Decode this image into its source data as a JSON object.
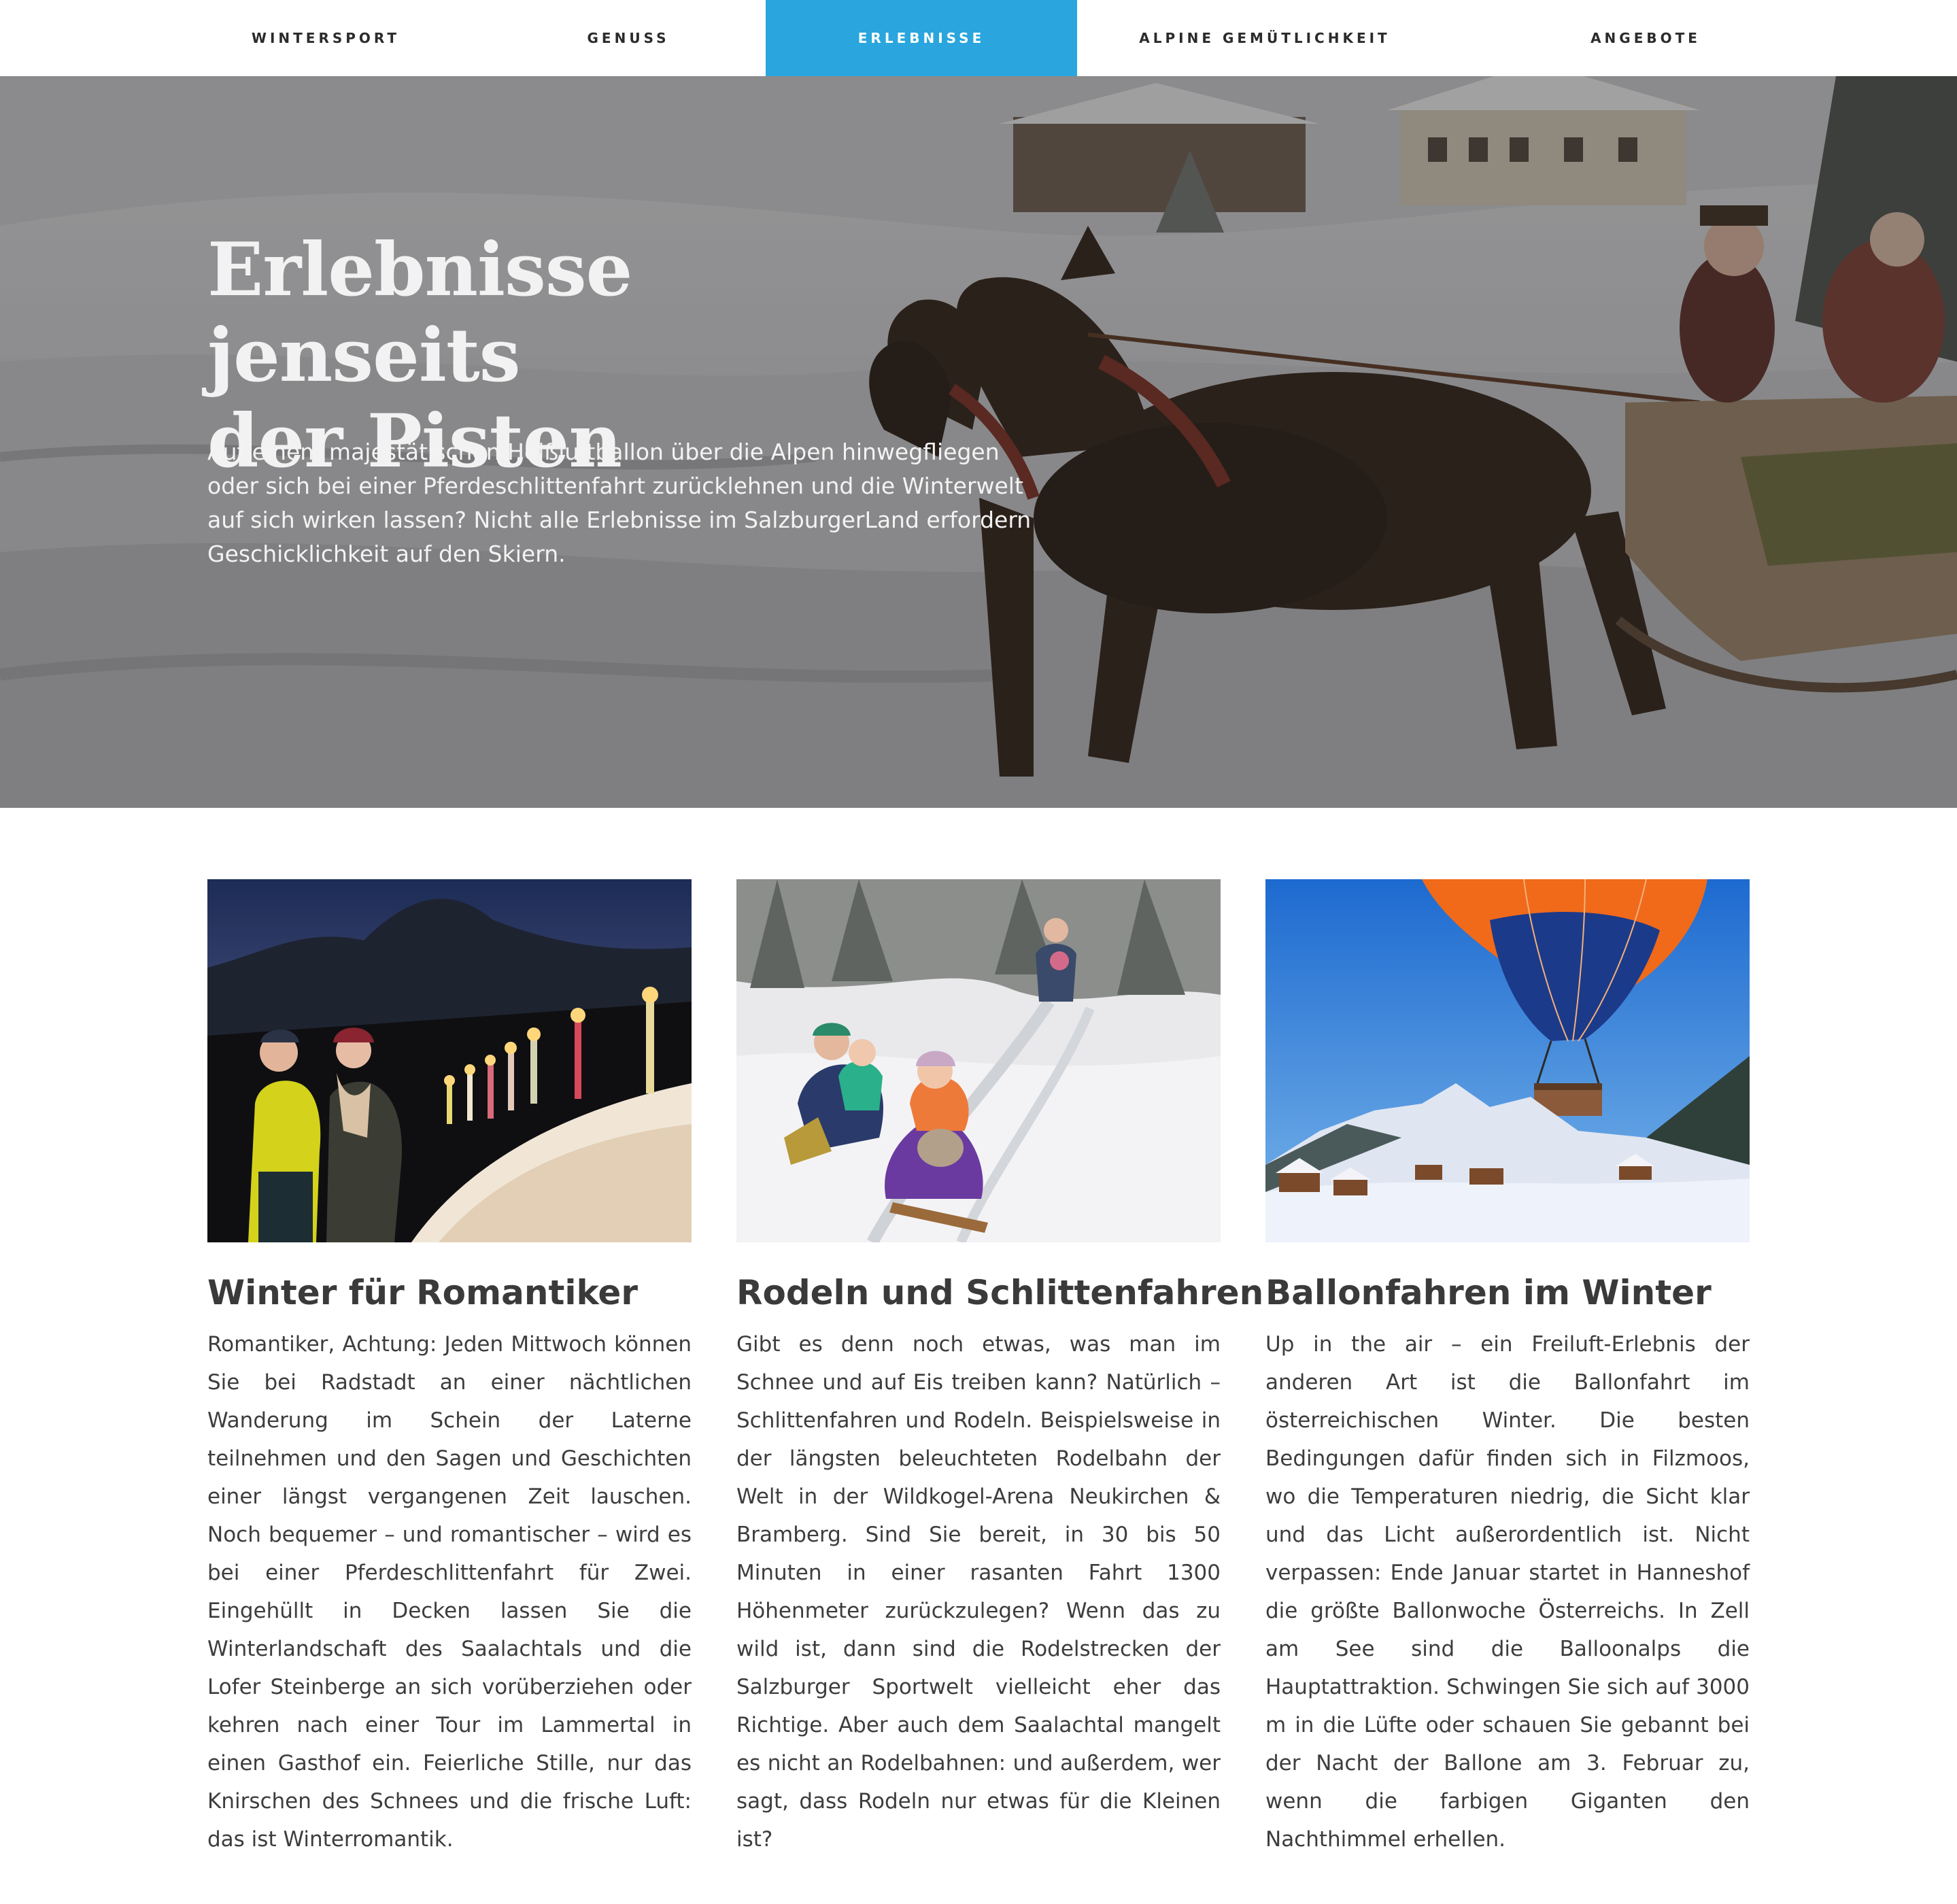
{
  "nav": {
    "items": [
      {
        "label": "WINTERSPORT"
      },
      {
        "label": "GENUSS"
      },
      {
        "label": "ERLEBNISSE"
      },
      {
        "label": "ALPINE GEMÜTLICHKEIT"
      },
      {
        "label": "ANGEBOTE"
      }
    ],
    "active": "ERLEBNISSE",
    "accent_color": "#2aa5dd"
  },
  "hero": {
    "title_line1": "Erlebnisse jenseits",
    "title_line2": "der Pisten",
    "text": "Auf einem majestätischen Heißluftballon über die Alpen hinwegfliegen oder sich bei einer Pferdeschlittenfahrt zurücklehnen und die Winterwelt auf sich wirken lassen? Nicht alle Erlebnisse im SalzburgerLand erfordern Geschicklichkeit auf den Skiern."
  },
  "cards": [
    {
      "title": "Winter für Romantiker",
      "text": "Romantiker, Achtung: Jeden Mittwoch können Sie bei Radstadt an einer nächtlichen Wanderung im Schein der Laterne teilnehmen und den Sagen und Geschichten einer längst vergangenen Zeit lauschen. Noch bequemer – und romantischer – wird es bei einer Pferdeschlittenfahrt für Zwei. Eingehüllt in Decken lassen Sie die Winterlandschaft des Saalachtals und die Lofer Steinberge an sich vorüberziehen oder kehren nach einer Tour im Lammertal in einen Gasthof ein. Feierliche Stille, nur das Knirschen des Schnees und die frische Luft: das ist Winterromantik."
    },
    {
      "title": "Rodeln und Schlittenfahren",
      "text": "Gibt es denn noch etwas, was man im Schnee und auf Eis treiben kann? Natürlich – Schlittenfahren und Rodeln. Beispielsweise in der längsten beleuchteten Rodelbahn der Welt in der Wildkogel-Arena Neukirchen & Bramberg. Sind Sie bereit, in 30 bis 50 Minuten in einer rasanten Fahrt 1300 Höhenmeter zurückzulegen? Wenn das zu wild ist, dann sind die Rodelstrecken der Salzburger Sportwelt vielleicht eher das Richtige. Aber auch dem Saalachtal mangelt es nicht an Rodelbahnen: und außerdem, wer sagt, dass Rodeln nur etwas für die Kleinen ist?"
    },
    {
      "title": "Ballonfahren im Winter",
      "text": "Up in the air – ein Freiluft-Erlebnis der anderen Art ist die Ballonfahrt im österreichischen Winter. Die besten Bedingungen dafür finden sich in Filzmoos, wo die Temperaturen niedrig, die Sicht klar und das Licht außerordentlich ist. Nicht verpassen: Ende Januar startet in Hanneshof die größte Ballonwoche Österreichs. In Zell am See sind die Balloonalps die Hauptattraktion. Schwingen Sie sich auf 3000 m in die Lüfte oder schauen Sie gebannt bei der Nacht der Ballone am 3. Februar zu, wenn die farbigen Giganten den Nachthimmel erhellen."
    }
  ]
}
